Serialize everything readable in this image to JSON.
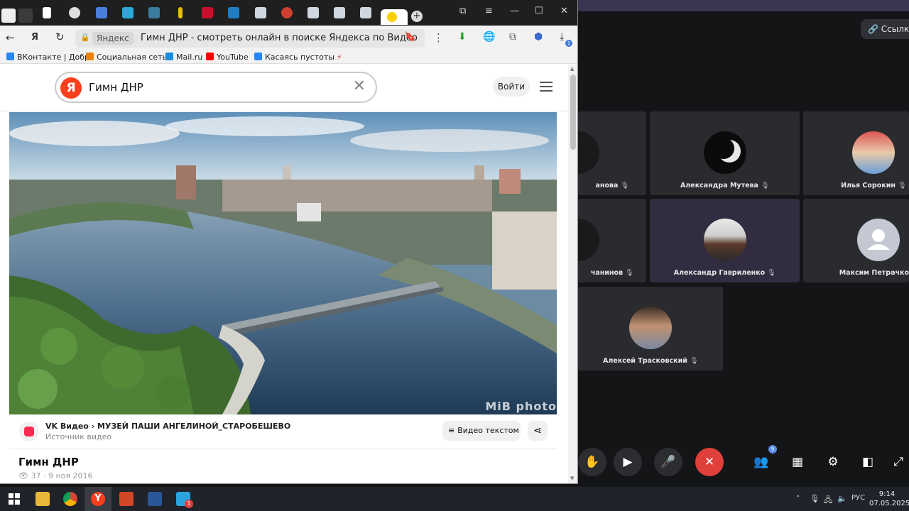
{
  "browser": {
    "address_chip": "Яндекс",
    "page_title": "Гимн ДНР - смотреть онлайн в поиске Яндекса по Видео",
    "bookmarks": [
      {
        "label": "ВКонтакте | Добр",
        "color": "#2787f5"
      },
      {
        "label": "Социальная сеть",
        "color": "#ee8208"
      },
      {
        "label": "Mail.ru",
        "color": "#168de2"
      },
      {
        "label": "YouTube",
        "color": "#ff0000"
      },
      {
        "label": "Касаясь пустоты",
        "color": "#2787f5"
      }
    ],
    "download_badge": "1"
  },
  "search": {
    "logo": "Я",
    "query": "Гимн ДНР",
    "login_label": "Войти"
  },
  "video": {
    "watermark": "MiB photo",
    "source_line": "VK Видео › МУЗЕЙ ПАШИ АНГЕЛИНОЙ_СТАРОБЕШЕВО",
    "source_sub": "Источник видео",
    "text_button": "Видео текстом",
    "title": "Гимн ДНР",
    "views": "37",
    "date": "9 ноя 2016"
  },
  "conference": {
    "link_button": "Ссылка",
    "participants": [
      {
        "name": "анова",
        "avatar": "dark"
      },
      {
        "name": "Александра Мутева",
        "avatar": "moon"
      },
      {
        "name": "Илья Сорокин",
        "avatar": "photo"
      },
      {
        "name": "чанинов",
        "avatar": "dark"
      },
      {
        "name": "Александр Гавриленко",
        "avatar": "photo2"
      },
      {
        "name": "Максим Петрачков",
        "avatar": "placeholder"
      },
      {
        "name": "Алексей Трасковский",
        "avatar": "photo3"
      }
    ],
    "people_badge": "9"
  },
  "taskbar": {
    "lang": "РУС",
    "time": "9:14",
    "date": "07.05.2025",
    "telegram_badge": "1"
  }
}
